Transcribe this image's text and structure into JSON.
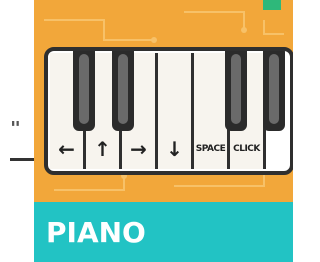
{
  "colors": {
    "card_background": "#f2a73a",
    "banner_background": "#22c3c4",
    "accent_green": "#2eb87a",
    "key_outline": "#2f2f2f"
  },
  "left_fragment": {
    "text": "\""
  },
  "keyboard": {
    "white_keys": [
      {
        "label": "←",
        "icon": "arrow-left-icon"
      },
      {
        "label": "↑",
        "icon": "arrow-up-icon"
      },
      {
        "label": "→",
        "icon": "arrow-right-icon"
      },
      {
        "label": "↓",
        "icon": "arrow-down-icon"
      },
      {
        "label": "SPACE",
        "icon": "space-key-icon"
      },
      {
        "label": "CLICK",
        "icon": "click-key-icon"
      }
    ]
  },
  "banner": {
    "title": "PIANO"
  }
}
